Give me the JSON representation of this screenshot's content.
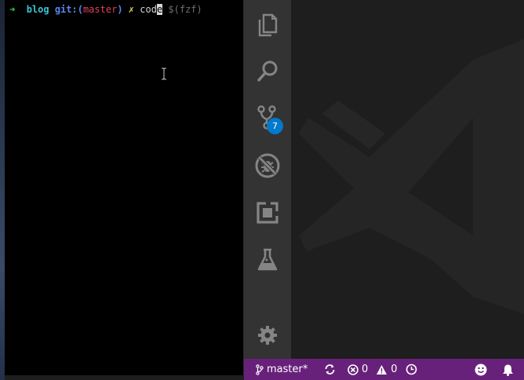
{
  "terminal": {
    "prompt_arrow": "➜",
    "dir": "blog",
    "git_label": "git:(",
    "branch": "master",
    "git_close": ")",
    "dirty_mark": "✗",
    "command_prefix": "cod",
    "command_cursor": "e",
    "hint": "$(fzf)"
  },
  "activity_bar": {
    "items": [
      {
        "name": "explorer-icon"
      },
      {
        "name": "search-icon"
      },
      {
        "name": "source-control-icon"
      },
      {
        "name": "debug-icon"
      },
      {
        "name": "extensions-icon"
      },
      {
        "name": "test-flask-icon"
      }
    ],
    "scm_badge": "7",
    "settings": "gear-icon"
  },
  "status_bar": {
    "branch": "master*",
    "errors": "0",
    "warnings": "0"
  },
  "colors": {
    "status_bar": "#68217a",
    "activity_bar": "#333333",
    "badge": "#007acc",
    "editor_bg": "#1e1e1e",
    "terminal_bg": "#000000"
  }
}
